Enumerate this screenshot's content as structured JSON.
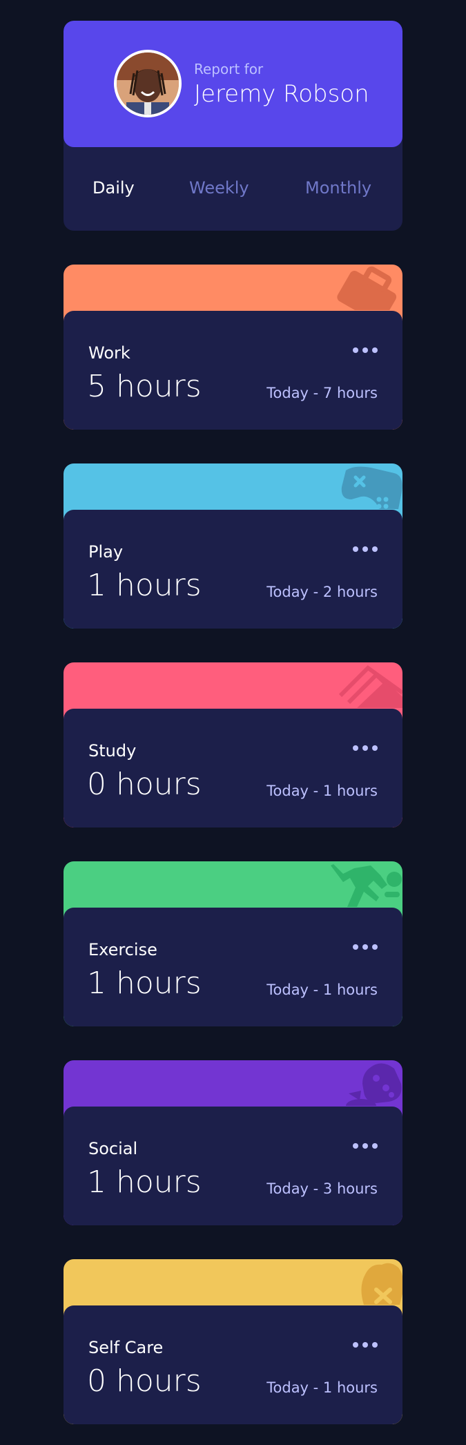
{
  "profile": {
    "report_label": "Report for",
    "name": "Jeremy Robson",
    "avatar_icon": "user-avatar"
  },
  "tabs": [
    {
      "label": "Daily",
      "active": true
    },
    {
      "label": "Weekly",
      "active": false
    },
    {
      "label": "Monthly",
      "active": false
    }
  ],
  "activities": [
    {
      "title": "Work",
      "hours": "5 hours",
      "previous": "Today - 7 hours",
      "color": "#ff8b64",
      "icon": "briefcase-icon"
    },
    {
      "title": "Play",
      "hours": "1 hours",
      "previous": "Today - 2 hours",
      "color": "#55c2e6",
      "icon": "gamepad-icon"
    },
    {
      "title": "Study",
      "hours": "0 hours",
      "previous": "Today - 1 hours",
      "color": "#ff5e7d",
      "icon": "books-icon"
    },
    {
      "title": "Exercise",
      "hours": "1 hours",
      "previous": "Today - 1 hours",
      "color": "#4bcf82",
      "icon": "running-icon"
    },
    {
      "title": "Social",
      "hours": "1 hours",
      "previous": "Today - 3 hours",
      "color": "#7335d2",
      "icon": "chat-icon"
    },
    {
      "title": "Self Care",
      "hours": "0 hours",
      "previous": "Today - 1 hours",
      "color": "#f1c75b",
      "icon": "heart-icon"
    }
  ],
  "colors": {
    "background": "#0e1323",
    "card": "#1c1f4a",
    "accent": "#5847eb",
    "muted_text": "#bdc1ff",
    "tab_inactive": "#7078c9"
  }
}
